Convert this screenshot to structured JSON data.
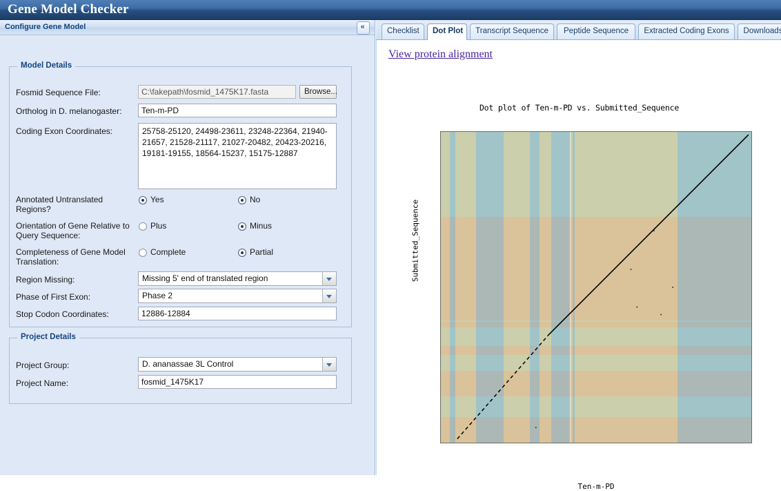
{
  "window": {
    "title": "Gene Model Checker"
  },
  "left_panel": {
    "header": "Configure Gene Model",
    "collapse_icon": "chevron-double-left-icon",
    "collapse_glyph": "«",
    "model_details": {
      "legend": "Model Details",
      "fosmid_label": "Fosmid Sequence File:",
      "fosmid_value": "C:\\fakepath\\fosmid_1475K17.fasta",
      "browse_label": "Browse...",
      "ortholog_label": "Ortholog in D. melanogaster:",
      "ortholog_value": "Ten-m-PD",
      "exon_label": "Coding Exon Coordinates:",
      "exon_value": "25758-25120, 24498-23611, 23248-22364, 21940-21657, 21528-21117, 21027-20482, 20423-20216, 19181-19155, 18564-15237, 15175-12887",
      "utr_label": "Annotated Untranslated Regions?",
      "utr_options": [
        {
          "label": "Yes",
          "selected": false
        },
        {
          "label": "No",
          "selected": true
        }
      ],
      "orientation_label": "Orientation of Gene Relative to Query Sequence:",
      "orientation_options": [
        {
          "label": "Plus",
          "selected": false
        },
        {
          "label": "Minus",
          "selected": true
        }
      ],
      "completeness_label": "Completeness of Gene Model Translation:",
      "completeness_options": [
        {
          "label": "Complete",
          "selected": false
        },
        {
          "label": "Partial",
          "selected": true
        }
      ],
      "region_missing_label": "Region Missing:",
      "region_missing_value": "Missing 5' end of translated region",
      "phase_label": "Phase of First Exon:",
      "phase_value": "Phase 2",
      "stop_codon_label": "Stop Codon Coordinates:",
      "stop_codon_value": "12886-12884"
    },
    "project_details": {
      "legend": "Project Details",
      "group_label": "Project Group:",
      "group_value": "D. ananassae 3L Control",
      "name_label": "Project Name:",
      "name_value": "fosmid_1475K17"
    }
  },
  "right_panel": {
    "tabs": [
      {
        "label": "Checklist",
        "active": false
      },
      {
        "label": "Dot Plot",
        "active": true
      },
      {
        "label": "Transcript Sequence",
        "active": false
      },
      {
        "label": "Peptide Sequence",
        "active": false
      },
      {
        "label": "Extracted Coding Exons",
        "active": false
      },
      {
        "label": "Downloads",
        "active": false
      }
    ],
    "alignment_link": "View protein alignment"
  },
  "chart_data": {
    "type": "scatter",
    "title": "Dot plot of Ten-m-PD vs. Submitted_Sequence",
    "xlabel": "Ten-m-PD",
    "ylabel": "Submitted_Sequence",
    "xlim": [
      0,
      3300
    ],
    "ylim": [
      0,
      3300
    ],
    "xticks": [
      500,
      1000,
      1500,
      2000,
      2500,
      3000
    ],
    "yticks": [
      500,
      1000,
      1500,
      2000,
      2500,
      3000
    ],
    "grid": false,
    "legend": "none",
    "colors": {
      "exon_blue": "#aed4e8",
      "exon_green": "#dde0c6",
      "exon_orange": "#fbcaa4",
      "overlap_mauve": "#d4bfc0",
      "diagonal": "#000000"
    },
    "x_bands": [
      {
        "start": 0,
        "end": 95,
        "color": "#dde0c6"
      },
      {
        "start": 95,
        "end": 155,
        "color": "#aed4e8"
      },
      {
        "start": 155,
        "end": 375,
        "color": "#dde0c6"
      },
      {
        "start": 375,
        "end": 665,
        "color": "#aed4e8"
      },
      {
        "start": 665,
        "end": 945,
        "color": "#dde0c6"
      },
      {
        "start": 945,
        "end": 1050,
        "color": "#aed4e8"
      },
      {
        "start": 1050,
        "end": 1175,
        "color": "#dde0c6"
      },
      {
        "start": 1175,
        "end": 1375,
        "color": "#aed4e8"
      },
      {
        "start": 1375,
        "end": 1400,
        "color": "#dde0c6"
      },
      {
        "start": 1400,
        "end": 1420,
        "color": "#aed4e8"
      },
      {
        "start": 1420,
        "end": 2515,
        "color": "#dde0c6"
      },
      {
        "start": 2515,
        "end": 3300,
        "color": "#aed4e8"
      }
    ],
    "y_bands": [
      {
        "start": 0,
        "end": 270,
        "color": "#fbcaa4"
      },
      {
        "start": 270,
        "end": 490,
        "color": "#dde0c6"
      },
      {
        "start": 490,
        "end": 760,
        "color": "#fbcaa4"
      },
      {
        "start": 760,
        "end": 930,
        "color": "#dde0c6"
      },
      {
        "start": 930,
        "end": 1030,
        "color": "#fbcaa4"
      },
      {
        "start": 1030,
        "end": 1225,
        "color": "#dde0c6"
      },
      {
        "start": 1225,
        "end": 1285,
        "color": "#fbcaa4"
      },
      {
        "start": 1285,
        "end": 1300,
        "color": "#dde0c6"
      },
      {
        "start": 1300,
        "end": 2400,
        "color": "#fbcaa4"
      },
      {
        "start": 2400,
        "end": 3300,
        "color": "#dde0c6"
      }
    ],
    "diagonal": {
      "description": "alignment diagonal from lower-left to upper-right",
      "x_start": 175,
      "y_start": 40,
      "x_end": 3270,
      "y_end": 3270,
      "dotted_below": 1150
    },
    "stray_points": [
      {
        "x": 1010,
        "y": 160
      },
      {
        "x": 2020,
        "y": 1840
      },
      {
        "x": 2465,
        "y": 1650
      },
      {
        "x": 2340,
        "y": 1360
      },
      {
        "x": 2265,
        "y": 2250
      },
      {
        "x": 2085,
        "y": 1440
      }
    ]
  }
}
